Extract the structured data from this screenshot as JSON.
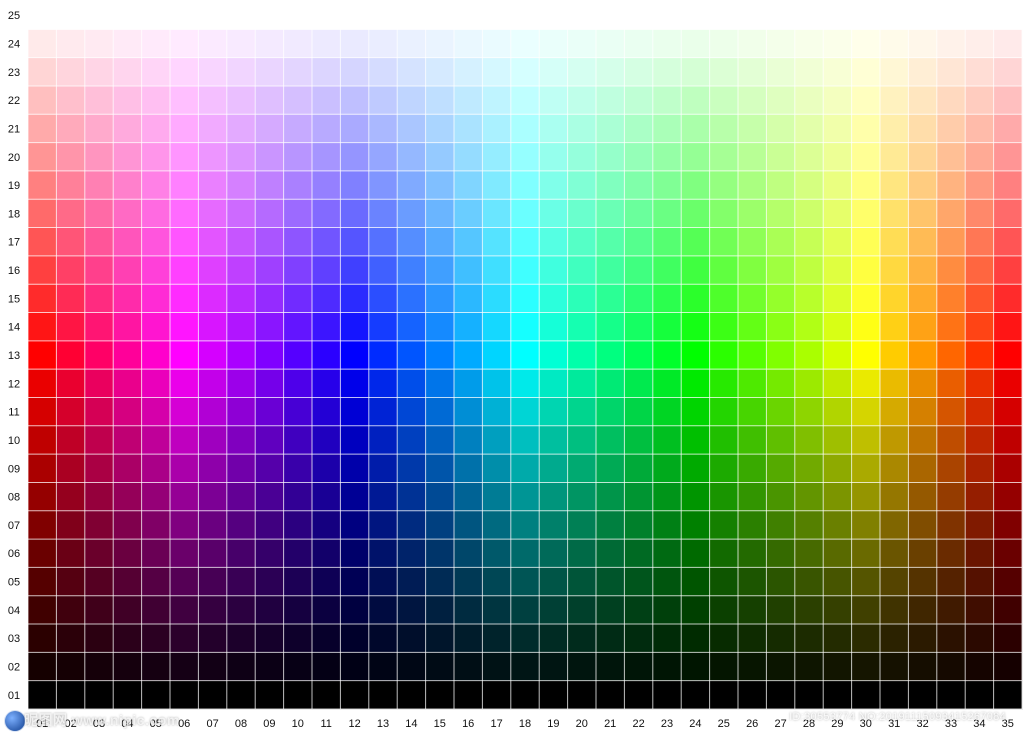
{
  "grid": {
    "columns": 35,
    "rows": 25,
    "gridline_color": "#ffffff",
    "hue_stops": [
      {
        "column": 1,
        "color": "#ff0000"
      },
      {
        "column": 6,
        "color": "#ff00ff"
      },
      {
        "column": 12,
        "color": "#0000ff"
      },
      {
        "column": 18,
        "color": "#00ffff"
      },
      {
        "column": 24,
        "color": "#00ff00"
      },
      {
        "column": 30,
        "color": "#ffff00"
      },
      {
        "column": 35,
        "color": "#ff0000"
      }
    ],
    "pure_row": 13,
    "top_row_color": "#ffffff",
    "bottom_row_color": "#000000"
  },
  "axis": {
    "x_labels": [
      "01",
      "02",
      "03",
      "04",
      "05",
      "06",
      "07",
      "08",
      "09",
      "10",
      "11",
      "12",
      "13",
      "14",
      "15",
      "16",
      "17",
      "18",
      "19",
      "20",
      "21",
      "22",
      "23",
      "24",
      "25",
      "26",
      "27",
      "28",
      "29",
      "30",
      "31",
      "32",
      "33",
      "34",
      "35"
    ],
    "y_labels": [
      "25",
      "24",
      "23",
      "22",
      "21",
      "20",
      "19",
      "18",
      "17",
      "16",
      "15",
      "14",
      "13",
      "12",
      "11",
      "10",
      "09",
      "08",
      "07",
      "06",
      "05",
      "04",
      "03",
      "02",
      "01"
    ]
  },
  "watermark": {
    "left_text": "昵图网 www.nipic.com",
    "right_text": "ID:30553774 NO:20191115093415267084",
    "logo_icon": "nipic-globe-icon"
  }
}
